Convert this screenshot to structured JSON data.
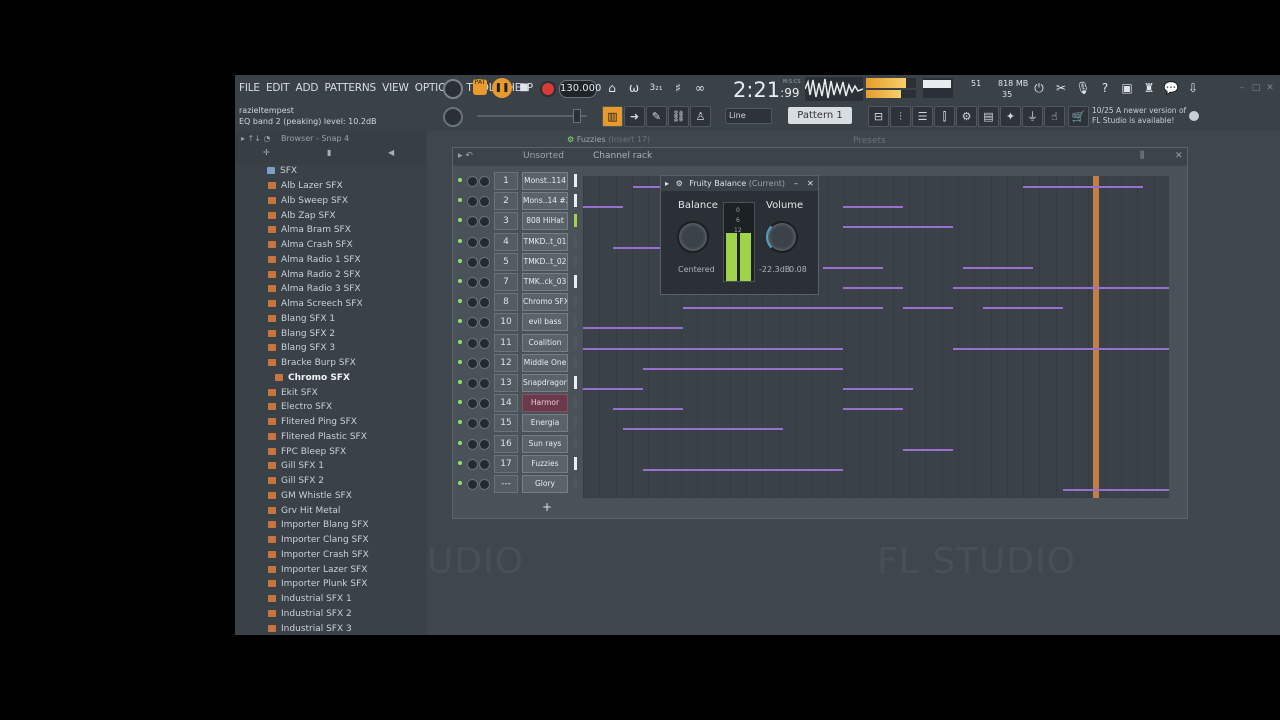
{
  "menu": [
    "FILE",
    "EDIT",
    "ADD",
    "PATTERNS",
    "VIEW",
    "OPTIONS",
    "TOOLS",
    "HELP"
  ],
  "hint": {
    "user": "razieltempest",
    "text": "EQ band 2 (peaking) level: 10.2dB"
  },
  "transport": {
    "pat_label": "PAT",
    "tempo": "130.000",
    "time_main": "2:21",
    "time_sub": "99",
    "time_unit": "M:S:CS"
  },
  "cpu": {
    "value": "51",
    "memory": "818 MB",
    "poly": "35"
  },
  "snap": "Line",
  "pattern": "Pattern 1",
  "update": {
    "line1": "10/25  A newer version of",
    "line2": "FL Studio is available!"
  },
  "browser": {
    "title": "Browser - Snap 4",
    "root": "SFX",
    "items": [
      "Alb Lazer SFX",
      "Alb Sweep SFX",
      "Alb Zap SFX",
      "Alma Bram SFX",
      "Alma Crash SFX",
      "Alma Radio 1 SFX",
      "Alma Radio 2 SFX",
      "Alma Radio 3 SFX",
      "Alma Screech SFX",
      "Blang SFX 1",
      "Blang SFX 2",
      "Blang SFX 3",
      "Bracke Burp SFX",
      "Chromo SFX",
      "Ekit SFX",
      "Electro SFX",
      "Flitered Ping SFX",
      "Flitered Plastic SFX",
      "FPC Bleep SFX",
      "Gill SFX 1",
      "Gill SFX 2",
      "GM Whistle SFX",
      "Grv Hit Metal",
      "Importer Blang SFX",
      "Importer Clang SFX",
      "Importer Crash SFX",
      "Importer Lazer SFX",
      "Importer Plunk SFX",
      "Industrial SFX 1",
      "Industrial SFX 2",
      "Industrial SFX 3"
    ],
    "selected": "Chromo SFX"
  },
  "mixer_tab": {
    "name": "Fuzzies",
    "insert": "(Insert 17)"
  },
  "rack": {
    "title": "Channel rack",
    "filter": "Unsorted",
    "presets": "Presets",
    "add": "+",
    "channels": [
      {
        "num": "1",
        "name": "Monst..114"
      },
      {
        "num": "2",
        "name": "Mons..14 #2"
      },
      {
        "num": "3",
        "name": "808 HiHat"
      },
      {
        "num": "4",
        "name": "TMKD..t_01"
      },
      {
        "num": "5",
        "name": "TMKD..t_02"
      },
      {
        "num": "7",
        "name": "TMK..ck_03"
      },
      {
        "num": "8",
        "name": "Chromo SFX"
      },
      {
        "num": "10",
        "name": "evil bass"
      },
      {
        "num": "11",
        "name": "Coalition"
      },
      {
        "num": "12",
        "name": "Middle One"
      },
      {
        "num": "13",
        "name": "Snapdragon"
      },
      {
        "num": "14",
        "name": "Harmor"
      },
      {
        "num": "15",
        "name": "Energia"
      },
      {
        "num": "16",
        "name": "Sun rays"
      },
      {
        "num": "17",
        "name": "Fuzzies"
      },
      {
        "num": "---",
        "name": "Glory"
      }
    ]
  },
  "fruity_balance": {
    "title": "Fruity Balance",
    "state": "(Current)",
    "balance_label": "Balance",
    "volume_label": "Volume",
    "balance_value": "Centered",
    "volume_value": "-22.3dB",
    "volume_gain": "0.08",
    "scale": [
      "0",
      "6",
      "12"
    ],
    "meter_left": 0.62,
    "meter_right": 0.62
  },
  "watermark": [
    "UDIO",
    "FL STUDIO"
  ],
  "colors": {
    "accent": "#e89b2c",
    "note": "#9a6fd0",
    "led": "#8ee06c"
  }
}
